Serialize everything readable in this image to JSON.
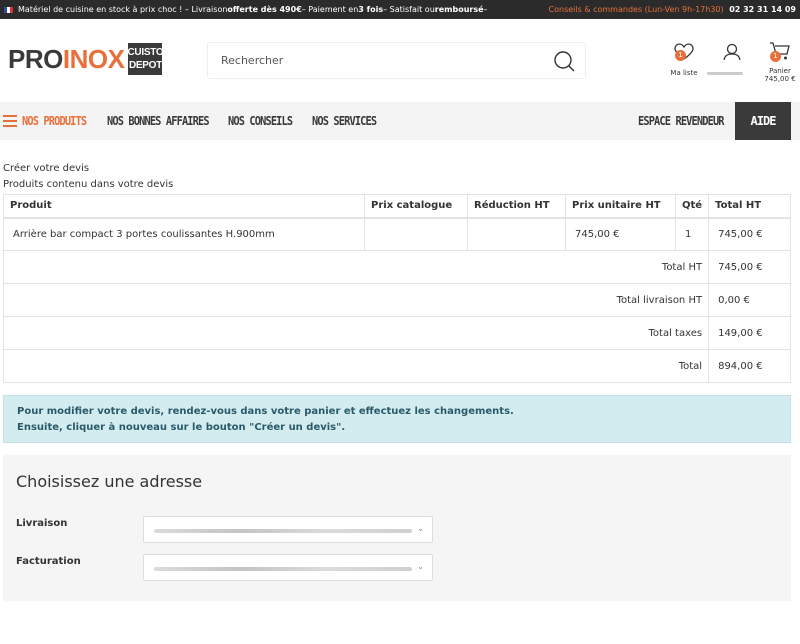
{
  "topbar": {
    "text1": "Matériel de cuisine en stock à prix choc ! – Livraison ",
    "text2": "offerte dès 490€",
    "text3": " – Paiement en ",
    "text4": "3 fois",
    "text5": " – Satisfait ou ",
    "text6": "remboursé",
    "text7": " –",
    "contact": "Conseils & commandes (Lun-Ven 9h-17h30)",
    "phone": "02 32 31 14 09"
  },
  "logo": {
    "pro": "PRO",
    "inox": "INOX",
    "badge_line1": "CUISTO",
    "badge_line2": "DEPOT"
  },
  "search": {
    "placeholder": "Rechercher"
  },
  "header": {
    "wishlist_label": "Ma liste",
    "wishlist_count": "1",
    "cart_label": "Panier",
    "cart_count": "1",
    "cart_total": "745,00 €"
  },
  "nav": {
    "products": "NOS PRODUITS",
    "deals": "NOS BONNES AFFAIRES",
    "advice": "NOS CONSEILS",
    "services": "NOS SERVICES",
    "reseller": "ESPACE REVENDEUR",
    "help": "AIDE"
  },
  "page": {
    "title": "Créer votre devis",
    "subtitle": "Produits contenu dans votre devis"
  },
  "table": {
    "headers": [
      "Produit",
      "Prix catalogue",
      "Réduction HT",
      "Prix unitaire HT",
      "Qté",
      "Total HT"
    ],
    "row": {
      "product": "Arrière bar compact 3 portes coulissantes H.900mm",
      "catalog": "",
      "discount": "",
      "unit": "745,00 €",
      "qty": "1",
      "total": "745,00 €"
    },
    "totals": [
      {
        "label": "Total HT",
        "value": "745,00 €"
      },
      {
        "label": "Total livraison HT",
        "value": "0,00 €"
      },
      {
        "label": "Total taxes",
        "value": "149,00 €"
      },
      {
        "label": "Total",
        "value": "894,00 €"
      }
    ]
  },
  "notice": {
    "line1": "Pour modifier votre devis, rendez-vous dans votre panier et effectuez les changements.",
    "line2": "Ensuite, cliquer à nouveau sur le bouton \"Créer un devis\"."
  },
  "address": {
    "title": "Choisissez une adresse",
    "delivery_label": "Livraison",
    "billing_label": "Facturation"
  },
  "colors": {
    "accent": "#e8703a",
    "dark": "#3a3a3a",
    "notice_bg": "#d3ecef"
  }
}
